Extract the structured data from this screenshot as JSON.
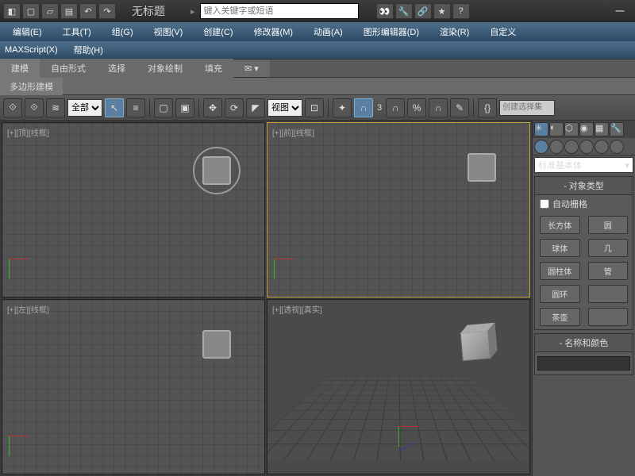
{
  "title": "无标题",
  "search_placeholder": "键入关键字或短语",
  "minimize": "—",
  "menu": {
    "edit": "编辑(E)",
    "tools": "工具(T)",
    "group": "组(G)",
    "view": "视图(V)",
    "create": "创建(C)",
    "modifier": "修改器(M)",
    "anim": "动画(A)",
    "graph": "图形编辑器(D)",
    "render": "渲染(R)",
    "custom": "自定义"
  },
  "menu2": {
    "maxscript": "MAXScript(X)",
    "help": "帮助(H)"
  },
  "ribbon": {
    "modeling": "建模",
    "freeform": "自由形式",
    "select": "选择",
    "objpaint": "对象绘制",
    "fill": "填充"
  },
  "ribbon2": {
    "polymodel": "多边形建模"
  },
  "toolbar": {
    "all": "全部",
    "view": "视图",
    "three": "3",
    "set_placeholder": "创建选择集"
  },
  "viewports": {
    "top": "[+][顶][线框]",
    "front": "[+][前][线框]",
    "left": "[+][左][线框]",
    "persp": "[+][透视][真实]"
  },
  "cmd": {
    "dropdown": "标准基本体",
    "obj_type": "对象类型",
    "autogrid": "自动栅格",
    "box": "长方体",
    "sphere": "球体",
    "cylinder": "圆柱体",
    "torus": "圆环",
    "teapot": "茶壶",
    "cone": "圆",
    "geo": "几",
    "tube": "管",
    "name_color": "名称和颜色"
  }
}
